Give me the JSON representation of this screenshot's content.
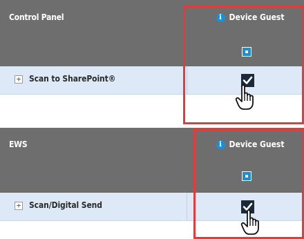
{
  "panels": [
    {
      "title": "Control Panel",
      "column_header": "Device Guest",
      "row_label": "Scan to SharePoint®",
      "expand_symbol": "+",
      "info_symbol": "i",
      "checkbox_checked": true
    },
    {
      "title": "EWS",
      "column_header": "Device Guest",
      "row_label": "Scan/Digital Send",
      "expand_symbol": "+",
      "info_symbol": "i",
      "checkbox_checked": true
    }
  ],
  "colors": {
    "header_bg": "#6e6e6e",
    "row_bg": "#dde9f6",
    "highlight": "#e03c3c",
    "accent": "#1b8fd6"
  },
  "icons": [
    "info-icon",
    "expand-icon",
    "checkbox-checked-icon",
    "hand-pointer-icon"
  ]
}
